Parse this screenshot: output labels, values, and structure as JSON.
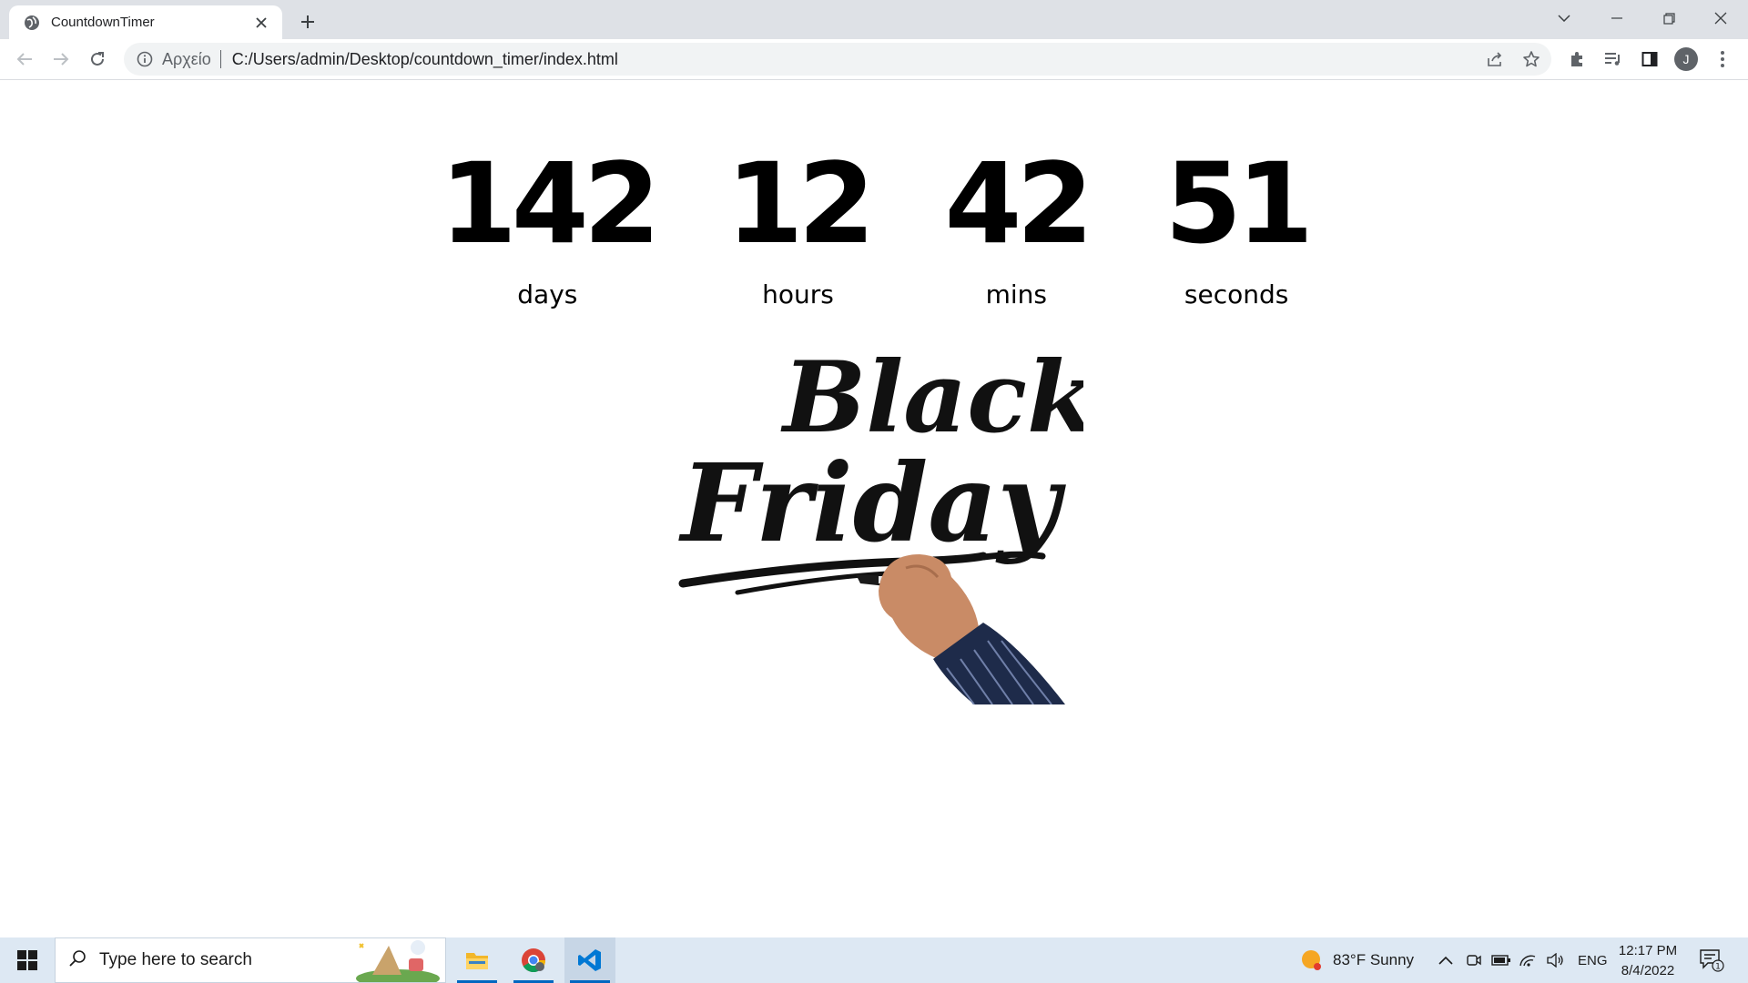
{
  "browser": {
    "tab_title": "CountdownTimer",
    "address": {
      "scheme_label": "Αρχείο",
      "url": "C:/Users/admin/Desktop/countdown_timer/index.html"
    },
    "profile_initial": "J"
  },
  "countdown": {
    "days": {
      "value": "142",
      "label": "days"
    },
    "hours": {
      "value": "12",
      "label": "hours"
    },
    "mins": {
      "value": "42",
      "label": "mins"
    },
    "seconds": {
      "value": "51",
      "label": "seconds"
    }
  },
  "artwork": {
    "line1": "Black",
    "line2": "Friday"
  },
  "taskbar": {
    "search_placeholder": "Type here to search",
    "weather": "83°F  Sunny",
    "language": "ENG",
    "time": "12:17 PM",
    "date": "8/4/2022",
    "notification_count": "1"
  },
  "colors": {
    "tabstrip": "#dee1e6",
    "taskbar": "#dde8f3",
    "accent": "#0067c0"
  }
}
